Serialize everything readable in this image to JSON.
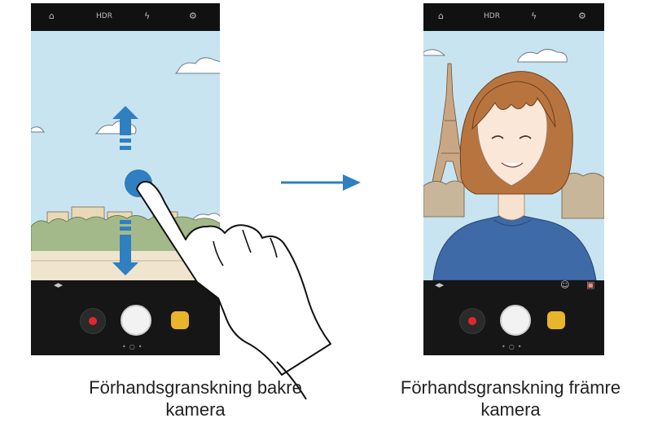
{
  "captions": {
    "back": "Förhandsgranskning bakre kamera",
    "front": "Förhandsgranskning främre kamera"
  },
  "camera_top_bar": {
    "hdr_label": "HDR",
    "icons": [
      "settings-toggle-icon",
      "hdr-icon",
      "flash-off-icon",
      "settings-gear-icon"
    ]
  },
  "colors": {
    "sky": "#c9e4f1",
    "arrow_blue": "#2f7fc1",
    "record_red": "#e3262c",
    "effect_gold": "#e8b52b",
    "shirt_blue": "#3f6aa8",
    "hair_brown": "#b8743f"
  },
  "gesture": "swipe-up-down"
}
